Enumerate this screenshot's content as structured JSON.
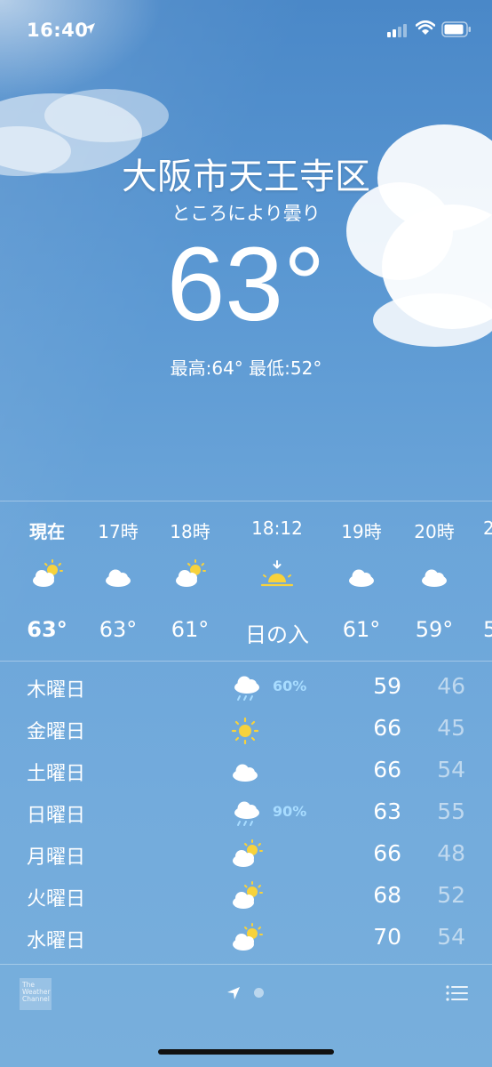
{
  "status_bar": {
    "time": "16:40"
  },
  "header": {
    "city": "大阪市天王寺区",
    "condition": "ところにより曇り",
    "temperature": "63°",
    "hi_lo": "最高:64° 最低:52°"
  },
  "hourly": [
    {
      "label": "現在",
      "icon": "partly-sunny-icon",
      "temp": "63°"
    },
    {
      "label": "17時",
      "icon": "cloud-icon",
      "temp": "63°"
    },
    {
      "label": "18時",
      "icon": "partly-sunny-icon",
      "temp": "61°"
    },
    {
      "label": "18:12",
      "icon": "sunset-icon",
      "temp": "日の入"
    },
    {
      "label": "19時",
      "icon": "cloud-icon",
      "temp": "61°"
    },
    {
      "label": "20時",
      "icon": "cloud-icon",
      "temp": "59°"
    },
    {
      "label": "2",
      "icon": "cloud-icon",
      "temp": "5"
    }
  ],
  "daily": [
    {
      "day": "木曜日",
      "icon": "rain-icon",
      "pop": "60%",
      "hi": "59",
      "lo": "46"
    },
    {
      "day": "金曜日",
      "icon": "sun-icon",
      "pop": "",
      "hi": "66",
      "lo": "45"
    },
    {
      "day": "土曜日",
      "icon": "cloud-icon",
      "pop": "",
      "hi": "66",
      "lo": "54"
    },
    {
      "day": "日曜日",
      "icon": "rain-icon",
      "pop": "90%",
      "hi": "63",
      "lo": "55"
    },
    {
      "day": "月曜日",
      "icon": "partly-sunny-icon",
      "pop": "",
      "hi": "66",
      "lo": "48"
    },
    {
      "day": "火曜日",
      "icon": "partly-sunny-icon",
      "pop": "",
      "hi": "68",
      "lo": "52"
    },
    {
      "day": "水曜日",
      "icon": "partly-sunny-icon",
      "pop": "",
      "hi": "70",
      "lo": "54"
    }
  ],
  "footer": {
    "logo_lines": [
      "The",
      "Weather",
      "Channel"
    ]
  },
  "colors": {
    "precip": "#a8dcff",
    "sun": "#f7d23c"
  }
}
